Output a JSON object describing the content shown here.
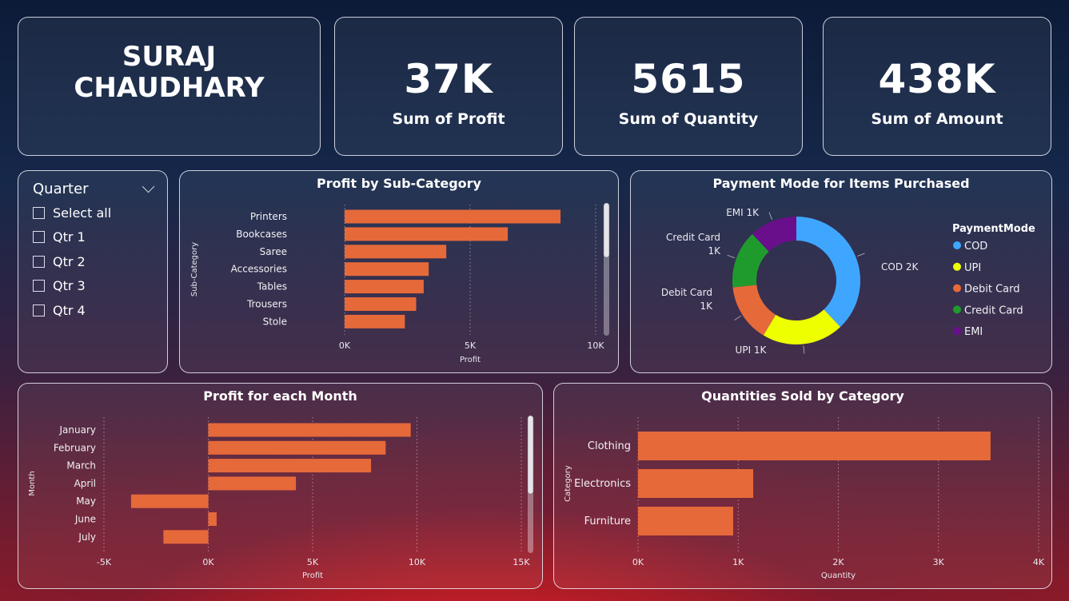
{
  "header": {
    "name_line1": "SURAJ",
    "name_line2": "CHAUDHARY"
  },
  "kpis": [
    {
      "value": "37K",
      "label": "Sum of Profit"
    },
    {
      "value": "5615",
      "label": "Sum of Quantity"
    },
    {
      "value": "438K",
      "label": "Sum of Amount"
    }
  ],
  "slicer": {
    "title": "Quarter",
    "options": [
      "Select all",
      "Qtr 1",
      "Qtr 2",
      "Qtr 3",
      "Qtr 4"
    ]
  },
  "colors": {
    "bar": "#e6693a",
    "cod": "#3fa6ff",
    "upi": "#eeff00",
    "debit": "#e6693a",
    "credit": "#1f9b2e",
    "emi": "#6a0f8c"
  },
  "chart_data": [
    {
      "id": "subcat",
      "type": "bar",
      "title": "Profit by Sub-Category",
      "xlabel": "Profit",
      "ylabel": "Sub-Category",
      "categories": [
        "Printers",
        "Bookcases",
        "Saree",
        "Accessories",
        "Tables",
        "Trousers",
        "Stole"
      ],
      "values": [
        8600,
        6500,
        4050,
        3350,
        3150,
        2850,
        2400
      ],
      "xlim": [
        0,
        10000
      ],
      "ticks": [
        0,
        5000,
        10000
      ],
      "tick_labels": [
        "0K",
        "5K",
        "10K"
      ]
    },
    {
      "id": "payment",
      "type": "pie",
      "title": "Payment Mode for Items Purchased",
      "legend_title": "PaymentMode",
      "categories": [
        "COD",
        "UPI",
        "Debit Card",
        "Credit Card",
        "EMI"
      ],
      "values": [
        2200,
        1200,
        850,
        850,
        700
      ],
      "data_labels": [
        "COD 2K",
        "UPI 1K",
        "Debit Card\n1K",
        "Credit Card\n1K",
        "EMI 1K"
      ],
      "legend_placement": "right"
    },
    {
      "id": "month",
      "type": "bar",
      "title": "Profit for each Month",
      "xlabel": "Profit",
      "ylabel": "Month",
      "categories": [
        "January",
        "February",
        "March",
        "April",
        "May",
        "June",
        "July"
      ],
      "values": [
        9700,
        8500,
        7800,
        4200,
        -3700,
        400,
        -2150
      ],
      "xlim": [
        -5000,
        15000
      ],
      "ticks": [
        -5000,
        0,
        5000,
        10000,
        15000
      ],
      "tick_labels": [
        "-5K",
        "0K",
        "5K",
        "10K",
        "15K"
      ]
    },
    {
      "id": "category",
      "type": "bar",
      "title": "Quantities Sold by Category",
      "xlabel": "Quantity",
      "ylabel": "Category",
      "categories": [
        "Clothing",
        "Electronics",
        "Furniture"
      ],
      "values": [
        3520,
        1150,
        950
      ],
      "xlim": [
        0,
        4000
      ],
      "ticks": [
        0,
        1000,
        2000,
        3000,
        4000
      ],
      "tick_labels": [
        "0K",
        "1K",
        "2K",
        "3K",
        "4K"
      ]
    }
  ]
}
